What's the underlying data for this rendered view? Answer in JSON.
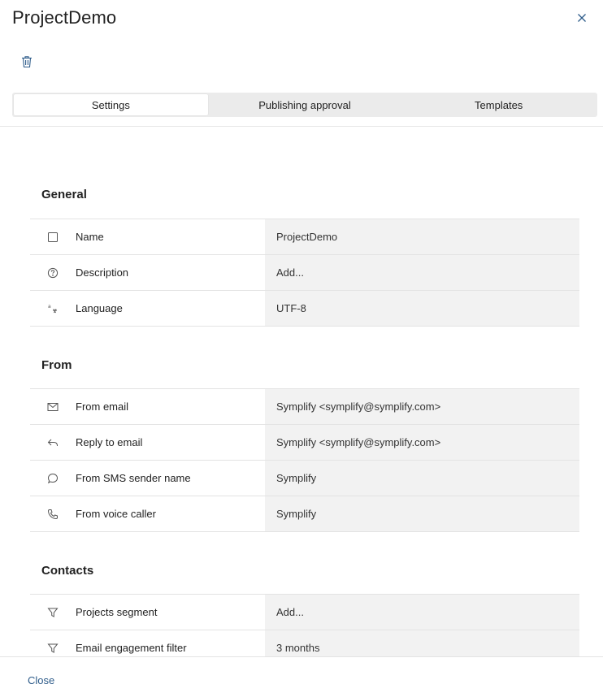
{
  "header": {
    "title": "ProjectDemo"
  },
  "tabs": [
    {
      "label": "Settings",
      "active": true
    },
    {
      "label": "Publishing approval",
      "active": false
    },
    {
      "label": "Templates",
      "active": false
    }
  ],
  "sections": {
    "general": {
      "title": "General",
      "rows": [
        {
          "icon": "checkbox-square-icon",
          "label": "Name",
          "value": "ProjectDemo"
        },
        {
          "icon": "question-circle-icon",
          "label": "Description",
          "value": "Add..."
        },
        {
          "icon": "language-icon",
          "label": "Language",
          "value": "UTF-8"
        }
      ]
    },
    "from": {
      "title": "From",
      "rows": [
        {
          "icon": "envelope-icon",
          "label": "From email",
          "value": "Symplify <symplify@symplify.com>"
        },
        {
          "icon": "reply-icon",
          "label": "Reply to email",
          "value": "Symplify <symplify@symplify.com>"
        },
        {
          "icon": "chat-bubble-icon",
          "label": "From SMS sender name",
          "value": "Symplify"
        },
        {
          "icon": "phone-icon",
          "label": "From voice caller",
          "value": "Symplify"
        }
      ]
    },
    "contacts": {
      "title": "Contacts",
      "rows": [
        {
          "icon": "filter-icon",
          "label": "Projects segment",
          "value": "Add..."
        },
        {
          "icon": "filter-icon",
          "label": "Email engagement filter",
          "value": "3 months"
        }
      ]
    }
  },
  "footer": {
    "close_label": "Close"
  },
  "colors": {
    "accent": "#2e5c8a",
    "value_bg": "#f2f2f2",
    "tab_bg": "#ebebeb"
  }
}
